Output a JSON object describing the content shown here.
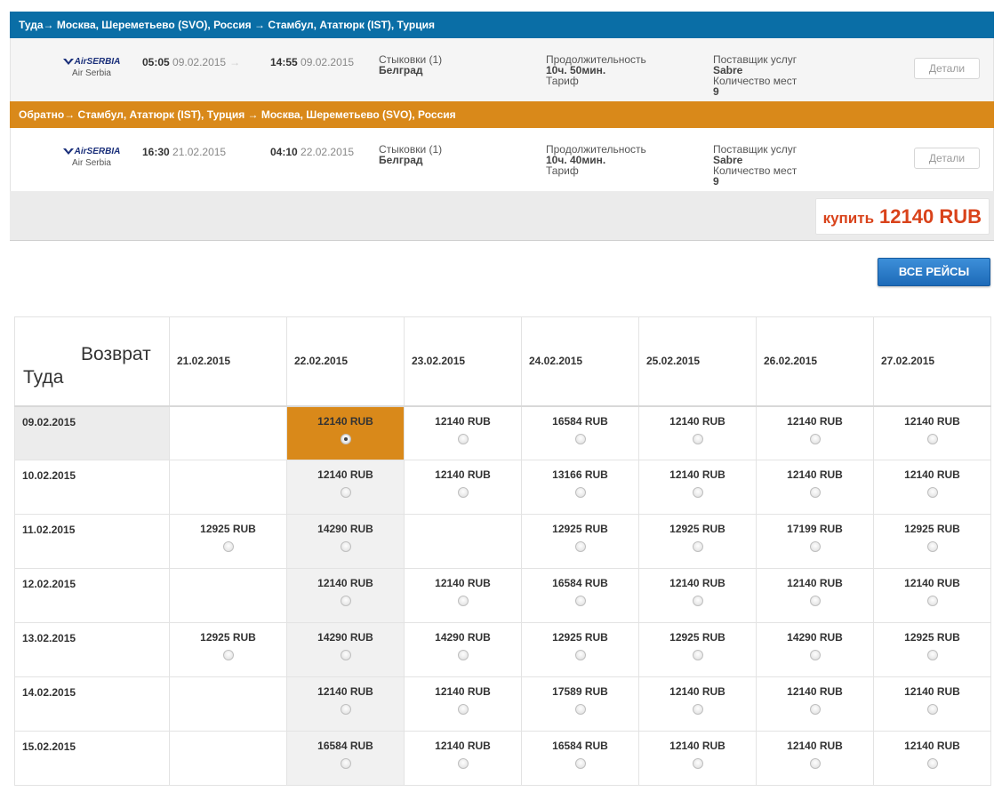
{
  "outbound": {
    "header": "Туда→ Москва, Шереметьево (SVO), Россия → Стамбул, Ататюрк (IST), Турция",
    "airline_logo": "AirSERBIA",
    "airline_name": "Air Serbia",
    "dep_time": "05:05",
    "dep_date": "09.02.2015",
    "dep_arrow": "→",
    "arr_time": "14:55",
    "arr_date": "09.02.2015",
    "stops_label": "Стыковки (1)",
    "stops_city": "Белград",
    "duration_label": "Продолжительность",
    "duration_value": "10ч. 50мин.",
    "fare_label": "Тариф",
    "provider_label": "Поставщик услуг",
    "provider_value": "Sabre",
    "seats_label": "Количество мест",
    "seats_value": "9",
    "details_label": "Детали"
  },
  "return": {
    "header": "Обратно→ Стамбул, Ататюрк (IST), Турция → Москва, Шереметьево (SVO), Россия",
    "airline_logo": "AirSERBIA",
    "airline_name": "Air Serbia",
    "dep_time": "16:30",
    "dep_date": "21.02.2015",
    "arr_time": "04:10",
    "arr_date": "22.02.2015",
    "stops_label": "Стыковки (1)",
    "stops_city": "Белград",
    "duration_label": "Продолжительность",
    "duration_value": "10ч. 40мин.",
    "fare_label": "Тариф",
    "provider_label": "Поставщик услуг",
    "provider_value": "Sabre",
    "seats_label": "Количество мест",
    "seats_value": "9",
    "details_label": "Детали"
  },
  "buy": {
    "label": "купить",
    "price": "12140 RUB"
  },
  "all_flights_label": "ВСЕ РЕЙСЫ",
  "matrix": {
    "corner_return": "Возврат",
    "corner_outbound": "Туда",
    "return_dates": [
      "21.02.2015",
      "22.02.2015",
      "23.02.2015",
      "24.02.2015",
      "25.02.2015",
      "26.02.2015",
      "27.02.2015"
    ],
    "rows": [
      {
        "date": "09.02.2015",
        "prices": [
          "",
          "12140 RUB",
          "12140 RUB",
          "16584 RUB",
          "12140 RUB",
          "12140 RUB",
          "12140 RUB"
        ]
      },
      {
        "date": "10.02.2015",
        "prices": [
          "",
          "12140 RUB",
          "12140 RUB",
          "13166 RUB",
          "12140 RUB",
          "12140 RUB",
          "12140 RUB"
        ]
      },
      {
        "date": "11.02.2015",
        "prices": [
          "12925 RUB",
          "14290 RUB",
          "",
          "12925 RUB",
          "12925 RUB",
          "17199 RUB",
          "12925 RUB"
        ]
      },
      {
        "date": "12.02.2015",
        "prices": [
          "",
          "12140 RUB",
          "12140 RUB",
          "16584 RUB",
          "12140 RUB",
          "12140 RUB",
          "12140 RUB"
        ]
      },
      {
        "date": "13.02.2015",
        "prices": [
          "12925 RUB",
          "14290 RUB",
          "14290 RUB",
          "12925 RUB",
          "12925 RUB",
          "14290 RUB",
          "12925 RUB"
        ]
      },
      {
        "date": "14.02.2015",
        "prices": [
          "",
          "12140 RUB",
          "12140 RUB",
          "17589 RUB",
          "12140 RUB",
          "12140 RUB",
          "12140 RUB"
        ]
      },
      {
        "date": "15.02.2015",
        "prices": [
          "",
          "16584 RUB",
          "12140 RUB",
          "16584 RUB",
          "12140 RUB",
          "12140 RUB",
          "12140 RUB"
        ]
      }
    ],
    "selected_row": 0,
    "selected_col": 1,
    "colors": {
      "outbound_header": "#0a6ea6",
      "return_header": "#d9891a",
      "selected_cell": "#d9891a",
      "buy_price": "#d9431b",
      "button": "#1d6ab8"
    }
  }
}
